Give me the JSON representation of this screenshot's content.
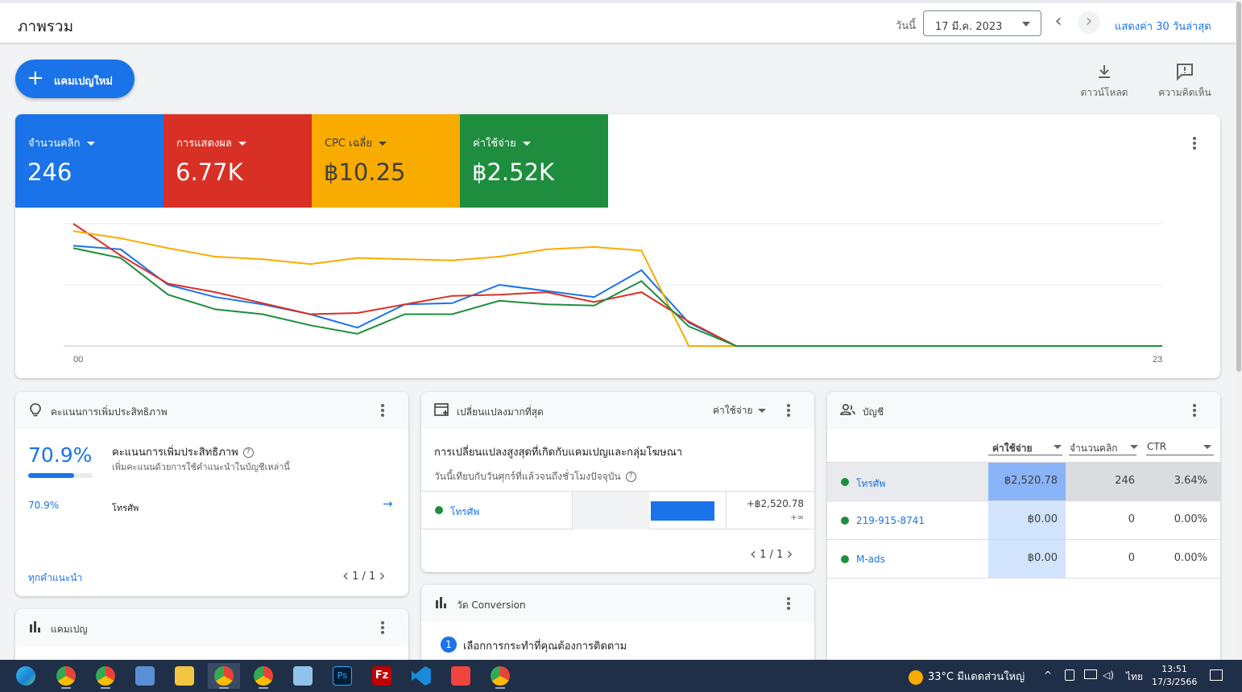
{
  "header": {
    "title": "ภาพรวม",
    "date_label": "วันนี้",
    "date_value": "17 มี.ค. 2023",
    "show_range": "แสดงค่า 30 วันล่าสุด"
  },
  "actions": {
    "new_campaign": "แคมเปญใหม่",
    "download": "ดาวน์โหลด",
    "feedback": "ความคิดเห็น"
  },
  "metrics": [
    {
      "label": "จำนวนคลิก",
      "value": "246",
      "color": "#1a73e8"
    },
    {
      "label": "การแสดงผล",
      "value": "6.77K",
      "color": "#d93025"
    },
    {
      "label": "CPC เฉลี่ย",
      "value": "฿10.25",
      "color": "#f9ab00"
    },
    {
      "label": "ค่าใช้จ่าย",
      "value": "฿2.52K",
      "color": "#1e8e3e"
    }
  ],
  "chart_data": {
    "type": "line",
    "x": [
      "00",
      "01",
      "02",
      "03",
      "04",
      "05",
      "06",
      "07",
      "08",
      "09",
      "10",
      "11",
      "12",
      "13",
      "14",
      "15",
      "16",
      "17",
      "18",
      "19",
      "20",
      "21",
      "22",
      "23"
    ],
    "x_tick_labels": [
      "00",
      "23"
    ],
    "grid": true,
    "series": [
      {
        "color": "#1a73e8",
        "values": [
          0.82,
          0.79,
          0.5,
          0.4,
          0.34,
          0.26,
          0.15,
          0.34,
          0.35,
          0.5,
          0.45,
          0.4,
          0.62,
          0.19,
          0.0,
          0.0,
          0.0,
          0.0,
          0.0,
          0.0,
          0.0,
          0.0,
          0.0,
          0.0
        ]
      },
      {
        "color": "#d93025",
        "values": [
          1.0,
          0.74,
          0.51,
          0.44,
          0.35,
          0.26,
          0.27,
          0.34,
          0.41,
          0.42,
          0.44,
          0.36,
          0.44,
          0.2,
          0.0,
          0.0,
          0.0,
          0.0,
          0.0,
          0.0,
          0.0,
          0.0,
          0.0,
          0.0
        ]
      },
      {
        "color": "#f9ab00",
        "values": [
          0.94,
          0.88,
          0.8,
          0.73,
          0.71,
          0.67,
          0.72,
          0.71,
          0.7,
          0.73,
          0.79,
          0.81,
          0.78,
          0.0,
          0.0,
          0.0,
          0.0,
          0.0,
          0.0,
          0.0,
          0.0,
          0.0,
          0.0,
          0.0
        ]
      },
      {
        "color": "#1e8e3e",
        "values": [
          0.8,
          0.72,
          0.42,
          0.3,
          0.26,
          0.17,
          0.1,
          0.26,
          0.26,
          0.37,
          0.34,
          0.33,
          0.53,
          0.16,
          0.0,
          0.0,
          0.0,
          0.0,
          0.0,
          0.0,
          0.0,
          0.0,
          0.0,
          0.0
        ]
      }
    ]
  },
  "optimization": {
    "title": "คะแนนการเพิ่มประสิทธิภาพ",
    "score": "70.9%",
    "score_fraction": 0.709,
    "heading": "คะแนนการเพิ่มประสิทธิภาพ",
    "subtitle": "เพิ่มคะแนนด้วยการใช้คำแนะนำในบัญชีเหล่านี้",
    "row_score": "70.9%",
    "row_name": "โทรศัพ",
    "row_arrow": "→",
    "all_recommendations": "ทุกคำแนะนำ",
    "pager": "1 / 1"
  },
  "campaigns": {
    "title": "แคมเปญ"
  },
  "changes": {
    "title": "เปลี่ยนแปลงมากที่สุด",
    "metric": "ค่าใช้จ่าย",
    "heading": "การเปลี่ยนแปลงสูงสุดที่เกิดกับแคมเปญและกลุ่มโฆษณา",
    "subtitle": "วันนี้เทียบกับวันศุกร์ที่แล้วจนถึงชั่วโมงปัจจุบัน",
    "row_name": "โทรศัพ",
    "row_value": "+฿2,520.78",
    "row_value2": "+∞",
    "pager": "1 / 1"
  },
  "conversion": {
    "title": "วัด Conversion",
    "step_number": "1",
    "step_text": "เลือกการกระทำที่คุณต้องการติดตาม"
  },
  "accounts": {
    "title": "บัญชี",
    "columns": [
      "ค่าใช้จ่าย",
      "จำนวนคลิก",
      "CTR"
    ],
    "rows": [
      {
        "name": "โทรศัพ",
        "cost": "฿2,520.78",
        "clicks": "246",
        "ctr": "3.64%"
      },
      {
        "name": "219-915-8741",
        "cost": "฿0.00",
        "clicks": "0",
        "ctr": "0.00%"
      },
      {
        "name": "M-ads",
        "cost": "฿0.00",
        "clicks": "0",
        "ctr": "0.00%"
      }
    ]
  },
  "taskbar": {
    "apps": [
      "edge-icon",
      "chrome-icon",
      "chrome-profile-icon",
      "pc-icon",
      "file-explorer-icon",
      "chrome-active-icon",
      "chrome-profile2-icon",
      "notepad-icon",
      "photoshop-icon",
      "filezilla-icon",
      "vscode-icon",
      "anydesk-icon",
      "chrome-profile3-icon"
    ],
    "weather": "33°C  มีแดดส่วนใหญ่",
    "lang": "ไทย",
    "time": "13:51",
    "date": "17/3/2566"
  }
}
